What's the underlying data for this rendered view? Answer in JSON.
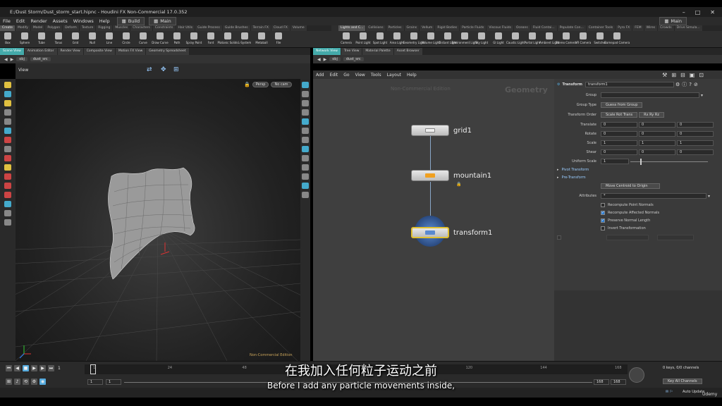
{
  "window": {
    "title": "E:/Dust Storm/Dust_storm_start.hipnc - Houdini FX Non-Commercial 17.0.352"
  },
  "menu": [
    "File",
    "Edit",
    "Render",
    "Assets",
    "Windows",
    "Help"
  ],
  "desktops": {
    "left": "Build",
    "right": "Main",
    "far_right": "Main"
  },
  "shelf_tabs_left": [
    "Create",
    "Modify",
    "Model",
    "Polygon",
    "Deform",
    "Texture",
    "Rigging",
    "Muscles",
    "Characters",
    "Constraints",
    "Hair Utils",
    "Guide Process",
    "Guide Brushes",
    "Terrain FX",
    "Cloud FX",
    "Volume"
  ],
  "shelf_tabs_right": [
    "Lights and C...",
    "Collisions",
    "Particles",
    "Grains",
    "Vellum",
    "Rigid Bodies",
    "Particle Fluids",
    "Viscous Fluids",
    "Oceans",
    "Fluid Contai...",
    "Populate Con...",
    "Container Tools",
    "Pyro FX",
    "FEM",
    "Wires",
    "Crowds",
    "Drive Simula..."
  ],
  "tools_left": [
    "Box",
    "Sphere",
    "Tube",
    "Torus",
    "Grid",
    "Null",
    "Line",
    "Circle",
    "Curve",
    "Draw Curve",
    "Path",
    "Spray Paint",
    "Font",
    "Platonic Solids",
    "L-System",
    "Metaball",
    "File"
  ],
  "tools_right": [
    "Camera",
    "Point Light",
    "Spot Light",
    "Area Light",
    "Geometry Light",
    "Volume Light",
    "Distant Light",
    "Environment Light",
    "Sky Light",
    "GI Light",
    "Caustic Light",
    "Portal Light",
    "Ambient Light",
    "Stereo Camera",
    "VR Camera",
    "Switcher",
    "Gamepad Camera"
  ],
  "pane_tabs_left": [
    "Scene View",
    "Animation Editor",
    "Render View",
    "Composite View",
    "Motion FX View",
    "Geometry Spreadsheet"
  ],
  "pane_tabs_right": [
    "Network View",
    "Tree View",
    "Material Palette",
    "Asset Browser"
  ],
  "path": {
    "obj": "obj",
    "node": "dust_src"
  },
  "viewport": {
    "label": "View",
    "persp": "Persp",
    "cam": "No cam",
    "watermark": "Non-Commercial Edition"
  },
  "network_menu": [
    "Add",
    "Edit",
    "Go",
    "View",
    "Tools",
    "Layout",
    "Help"
  ],
  "network": {
    "watermark": "Non-Commercial Edition",
    "context": "Geometry",
    "nodes": [
      {
        "name": "grid1",
        "icon_color": "#f0f0f0"
      },
      {
        "name": "mountain1",
        "icon_color": "#f0a020"
      },
      {
        "name": "transform1",
        "icon_color": "#5a8ad0"
      }
    ]
  },
  "parms": {
    "type": "Transform",
    "node": "transform1",
    "group_label": "Group",
    "group_type_label": "Group Type",
    "group_type": "Guess from Group",
    "xform_order_label": "Transform Order",
    "xform_order": "Scale Rot Trans",
    "rot_order": "Rx Ry Rz",
    "translate_label": "Translate",
    "translate": [
      "0",
      "0",
      "0"
    ],
    "rotate_label": "Rotate",
    "rotate": [
      "0",
      "0",
      "0"
    ],
    "scale_label": "Scale",
    "scale": [
      "1",
      "1",
      "1"
    ],
    "shear_label": "Shear",
    "shear": [
      "0",
      "0",
      "0"
    ],
    "uniform_label": "Uniform Scale",
    "uniform": "1",
    "pivot": "Pivot Transform",
    "pretransform": "Pre-Transform",
    "move_centroid": "Move Centroid to Origin",
    "attributes_label": "Attributes",
    "attributes": "*",
    "checks": [
      {
        "label": "Recompute Point Normals",
        "on": false
      },
      {
        "label": "Recompute Affected Normals",
        "on": true
      },
      {
        "label": "Preserve Normal Length",
        "on": true
      },
      {
        "label": "Invert Transformation",
        "on": false
      }
    ]
  },
  "timeline": {
    "frame": "1",
    "ticks": [
      "1",
      "24",
      "48",
      "72",
      "96",
      "120",
      "144",
      "168"
    ],
    "start": "1",
    "start2": "1",
    "end": "168",
    "end2": "168",
    "keys": "0 keys, 0/0 channels",
    "key_all": "Key All Channels",
    "auto_update": "Auto Update"
  },
  "subtitles": {
    "cn": "在我加入任何粒子运动之前",
    "en": "Before I add any particle movements inside,"
  },
  "brand": "Udemy"
}
